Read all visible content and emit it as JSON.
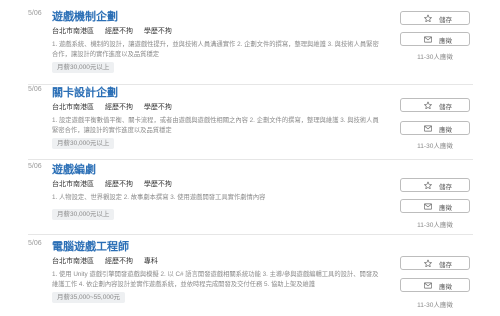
{
  "jobs": [
    {
      "date": "5/06",
      "title": "遊戲機制企劃",
      "location": "台北市南港區",
      "experience": "經歷不拘",
      "education": "學歷不拘",
      "description": "1. 遊戲系統、機制的設計，讓遊戲性提升，並與技術人員溝通實作 2. 企劃文件的撰寫，整理與維護 3. 與技術人員緊密合作，讓設計的實作進度以及品質穩定",
      "salary": "月薪30,000元以上",
      "save_label": "儲存",
      "apply_label": "應徵",
      "applicants": "11-30人應徵"
    },
    {
      "date": "5/06",
      "title": "關卡設計企劃",
      "location": "台北市南港區",
      "experience": "經歷不拘",
      "education": "學歷不拘",
      "description": "1. 設定遊戲平衡數值平衡、關卡流程，或者由遊戲與遊戲性相關之內容 2. 企劃文件的撰寫，整理與維護 3. 與技術人員緊密合作，讓設計的實作進度以及品質穩定",
      "salary": "月薪30,000元以上",
      "save_label": "儲存",
      "apply_label": "應徵",
      "applicants": "11-30人應徵"
    },
    {
      "date": "5/06",
      "title": "遊戲編劇",
      "location": "台北市南港區",
      "experience": "經歷不拘",
      "education": "學歷不拘",
      "description": "1. 人物設定、世界觀設定 2. 故事劇本撰寫 3. 使用遊戲開發工具實作劇情內容",
      "salary": "月薪30,000元以上",
      "save_label": "儲存",
      "apply_label": "應徵",
      "applicants": "11-30人應徵"
    },
    {
      "date": "5/06",
      "title": "電腦遊戲工程師",
      "location": "台北市南港區",
      "experience": "經歷不拘",
      "education": "專科",
      "description": "1. 使用 Unity 遊戲引擎開發遊戲與模擬 2. 以 C# 語言開發遊戲相關系統功能 3. 主導/參與遊戲編輯工具的設計、開發及維護工作 4. 依企劃內容設計並實作遊戲系統，並依時程完成開發及交付任務 5. 協助上架及維護",
      "salary": "月薪35,000~55,000元",
      "save_label": "儲存",
      "apply_label": "應徵",
      "applicants": "11-30人應徵"
    }
  ],
  "colors": {
    "title": "#2b6fb6",
    "muted": "#8a8a8a",
    "salary_bg": "#eef0f2",
    "divider": "#e6e6e6"
  },
  "icons": {
    "save": "star-outline-icon",
    "apply": "envelope-icon"
  }
}
